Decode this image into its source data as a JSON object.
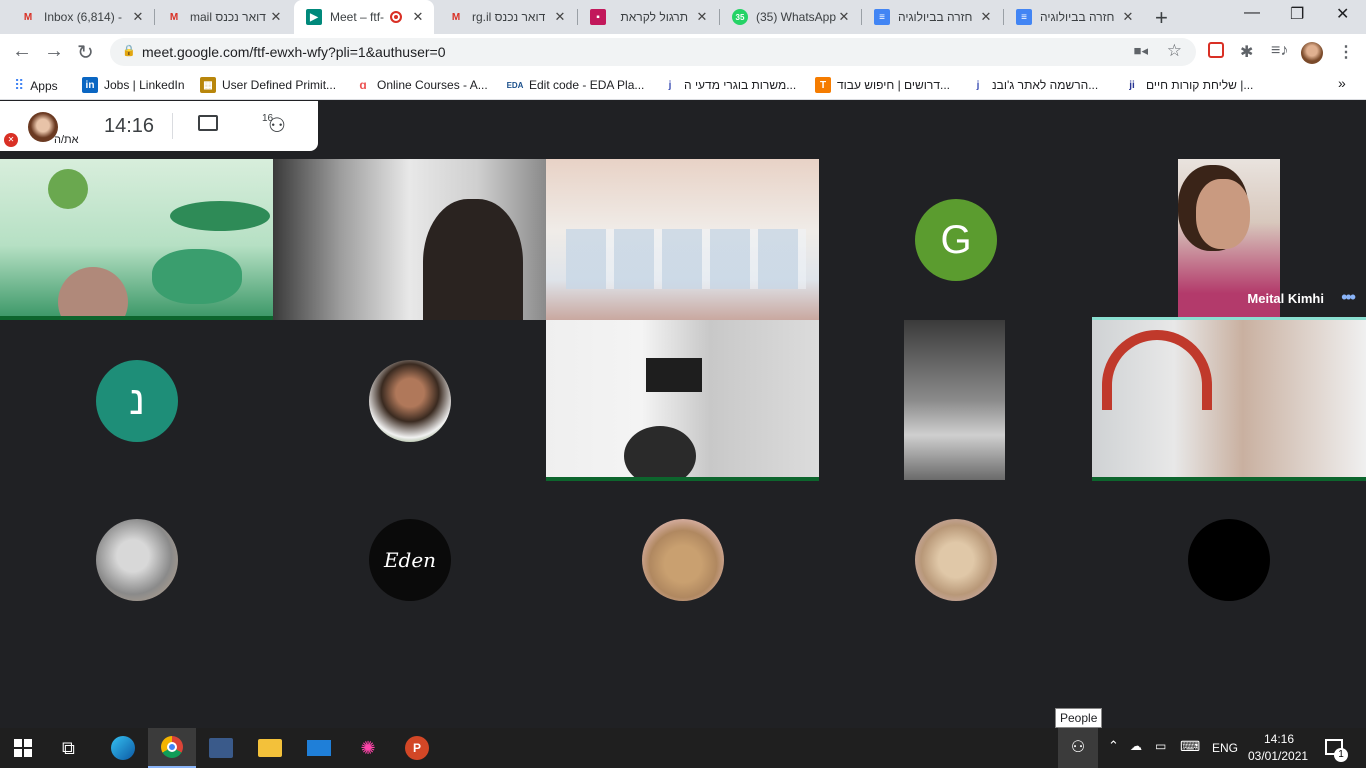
{
  "browser": {
    "tabs": [
      {
        "title": "Inbox (6,814) -",
        "icon": "gmail-icon",
        "color": "#d93025"
      },
      {
        "title": "mail דואר נכנס",
        "icon": "gmail-icon",
        "color": "#d93025"
      },
      {
        "title": "Meet – ftf-",
        "icon": "meet-icon",
        "color": "#00897b",
        "active": true
      },
      {
        "title": "rg.il דואר נכנס",
        "icon": "gmail-icon",
        "color": "#d93025"
      },
      {
        "title": "תרגול לקראת",
        "icon": "forms-icon",
        "color": "#c2185b"
      },
      {
        "title": "(35) WhatsApp",
        "icon": "whatsapp-icon",
        "color": "#25d366",
        "badge": "35"
      },
      {
        "title": "חזרה בביולוגיה",
        "icon": "docs-icon",
        "color": "#4285f4"
      },
      {
        "title": "חזרה בביולוגיה",
        "icon": "docs-icon",
        "color": "#4285f4"
      }
    ],
    "url": "meet.google.com/ftf-ewxh-wfy?pli=1&authuser=0",
    "bookmarks": [
      {
        "label": "Apps",
        "icon": "apps-grid-icon",
        "color": "#4285f4"
      },
      {
        "label": "Jobs | LinkedIn",
        "icon": "linkedin-icon",
        "color": "#0a66c2"
      },
      {
        "label": "User Defined Primit...",
        "icon": "bookmark-site-icon",
        "color": "#b8860b"
      },
      {
        "label": "Online Courses - A...",
        "icon": "udemy-icon",
        "color": "#ec5252"
      },
      {
        "label": "Edit code - EDA Pla...",
        "icon": "eda-icon",
        "color": "#1a4f8b"
      },
      {
        "label": "משרות בוגרי מדעי ה...",
        "icon": "jobinfo-icon",
        "color": "#3f51b5"
      },
      {
        "label": "דרושים | חיפוש עבוד...",
        "icon": "t-site-icon",
        "color": "#f57c00"
      },
      {
        "label": "הרשמה לאתר ג'ובנ...",
        "icon": "jobinfo-icon",
        "color": "#3f51b5"
      },
      {
        "label": "שליחת קורות חיים |...",
        "icon": "ji-icon",
        "color": "#283593"
      }
    ]
  },
  "meet": {
    "time": "14:16",
    "participant_count": "16",
    "self_label": "את/ה",
    "pinned_name": "Meital Kimhi",
    "avatars": [
      {
        "letter": "G",
        "color": "#5b9c2f"
      },
      {
        "letter": "נ",
        "color": "#1e8e78"
      },
      {
        "letter": "Eden",
        "color": "#0a0a0a"
      }
    ]
  },
  "taskbar": {
    "tooltip": "People",
    "lang": "ENG",
    "time": "14:16",
    "date": "03/01/2021",
    "notification_count": "1"
  }
}
